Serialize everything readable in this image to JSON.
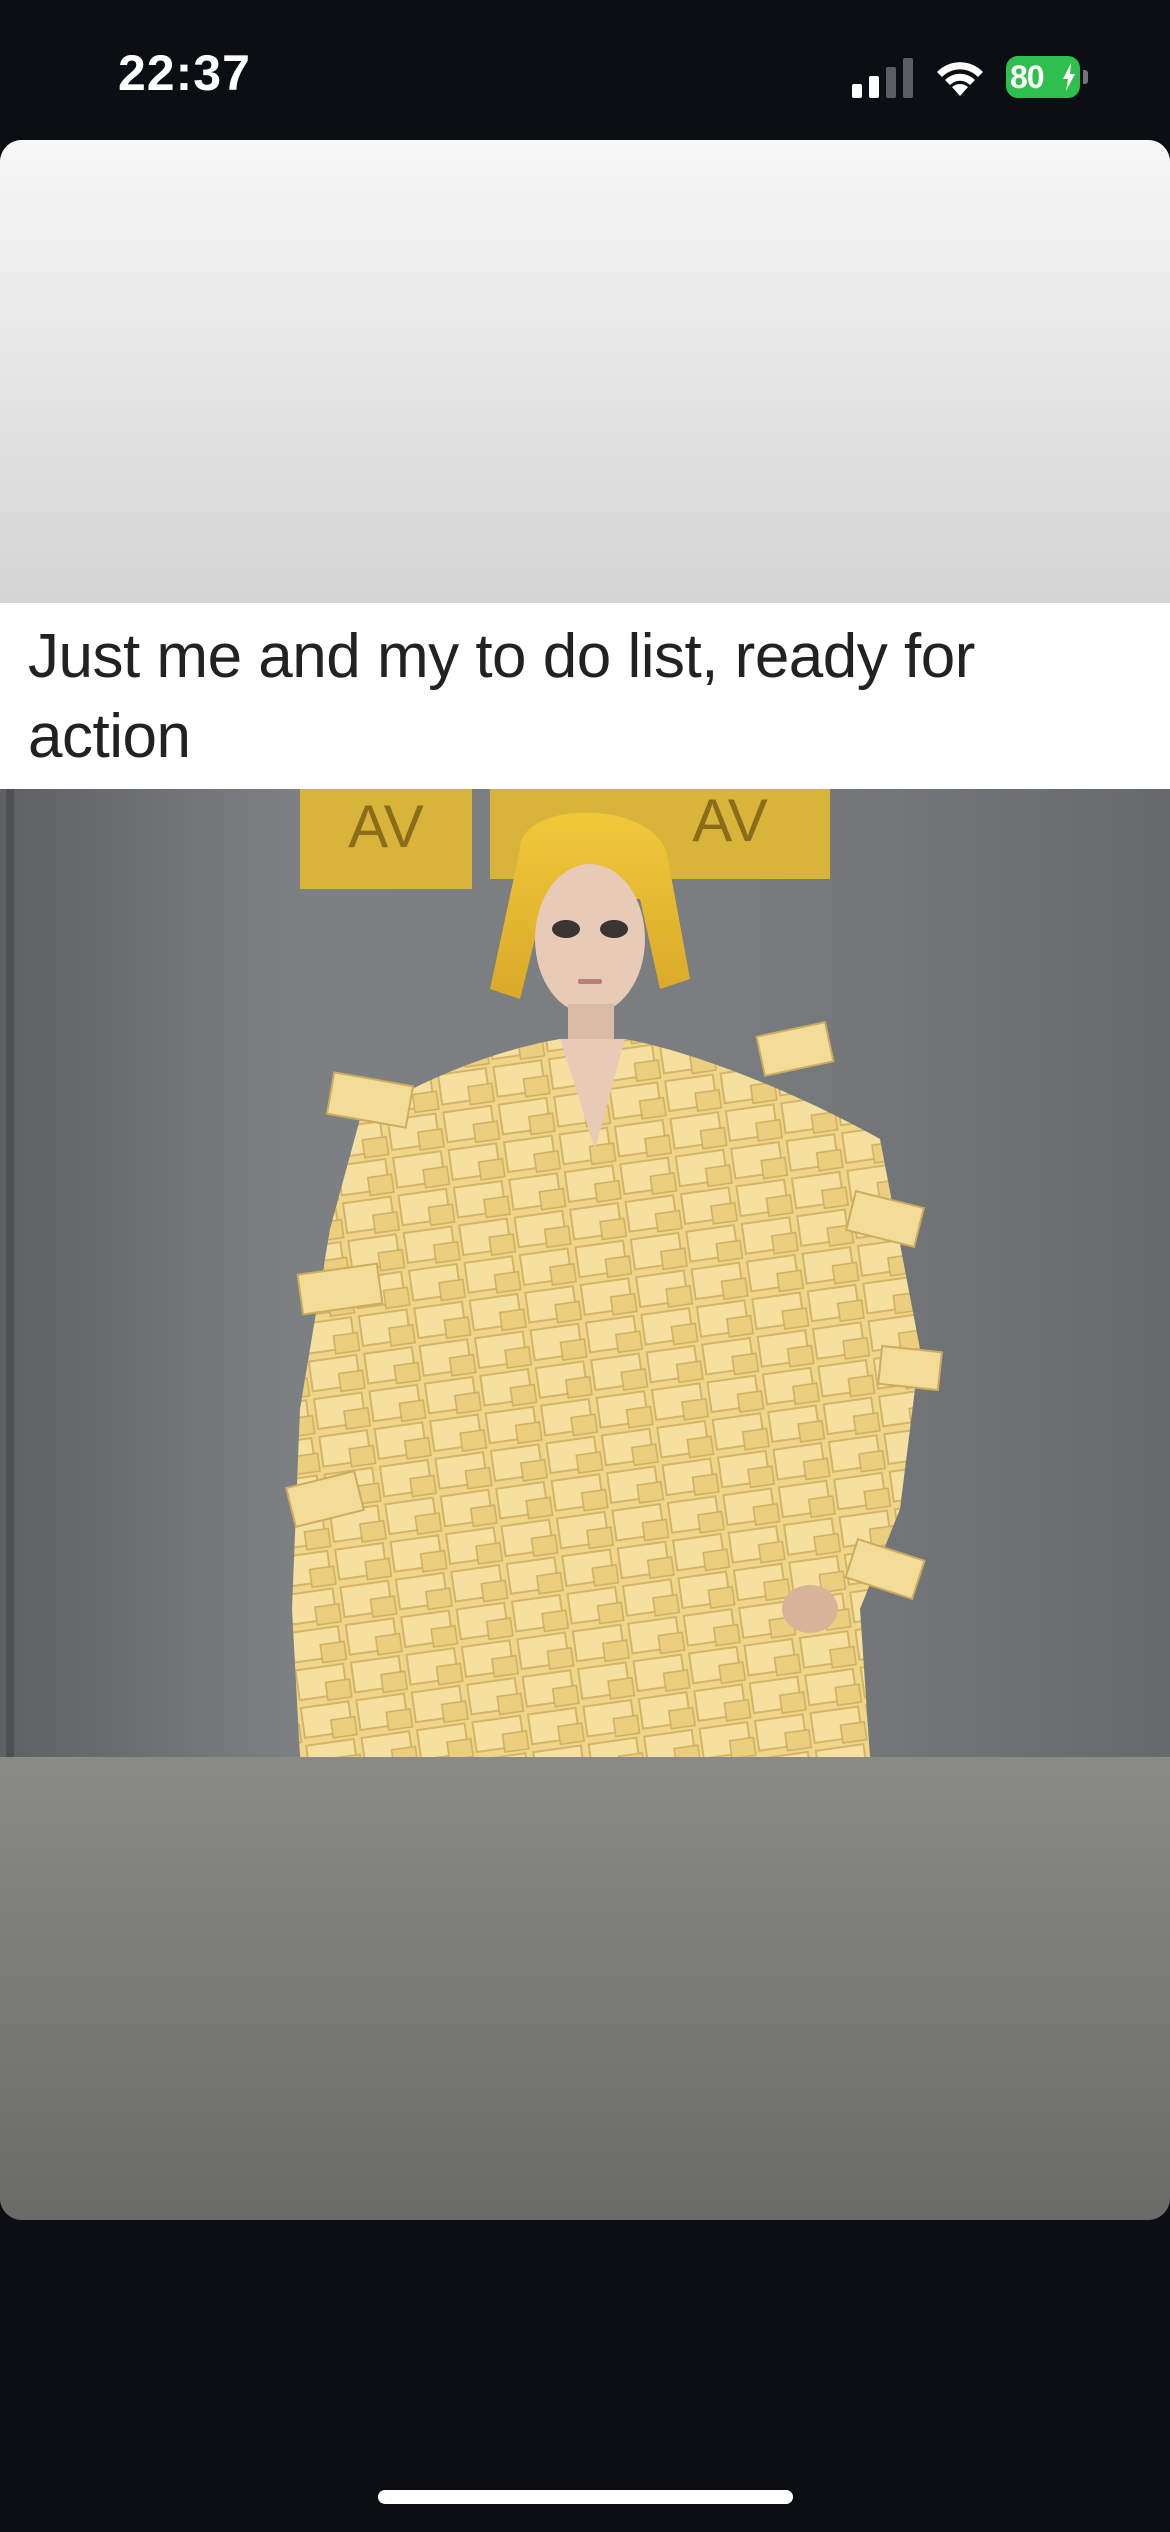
{
  "status_bar": {
    "time": "22:37",
    "signal_icon": "cellular-signal-icon",
    "wifi_icon": "wifi-icon",
    "battery_level": "80",
    "battery_charging_icon": "bolt-icon",
    "battery_color": "#2fbf4f"
  },
  "media": {
    "caption": "Just me and my to do list, ready for action",
    "sign_text_left": "AV",
    "sign_text_right": "AV"
  },
  "colors": {
    "background": "#0b0e13",
    "caption_text": "#222222",
    "sticky_note": "#f2d98a"
  }
}
